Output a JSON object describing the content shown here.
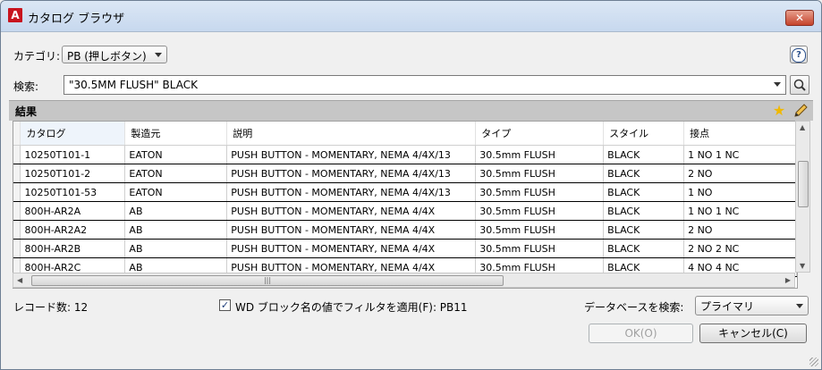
{
  "window": {
    "title": "カタログ ブラウザ",
    "app_icon": "A",
    "close_glyph": "✕"
  },
  "category": {
    "label": "カテゴリ:",
    "selected": "PB (押しボタン)"
  },
  "search": {
    "label": "検索:",
    "value": "\"30.5MM FLUSH\" BLACK"
  },
  "results": {
    "title": "結果"
  },
  "table": {
    "columns": [
      "カタログ",
      "製造元",
      "説明",
      "タイプ",
      "スタイル",
      "接点"
    ],
    "rows": [
      [
        "10250T101-1",
        "EATON",
        "PUSH BUTTON - MOMENTARY, NEMA 4/4X/13",
        "30.5mm FLUSH",
        "BLACK",
        "1 NO 1 NC"
      ],
      [
        "10250T101-2",
        "EATON",
        "PUSH BUTTON - MOMENTARY, NEMA 4/4X/13",
        "30.5mm FLUSH",
        "BLACK",
        "2 NO"
      ],
      [
        "10250T101-53",
        "EATON",
        "PUSH BUTTON - MOMENTARY, NEMA 4/4X/13",
        "30.5mm FLUSH",
        "BLACK",
        "1 NO"
      ],
      [
        "800H-AR2A",
        "AB",
        "PUSH BUTTON - MOMENTARY, NEMA 4/4X",
        "30.5mm FLUSH",
        "BLACK",
        "1 NO 1 NC"
      ],
      [
        "800H-AR2A2",
        "AB",
        "PUSH BUTTON - MOMENTARY, NEMA 4/4X",
        "30.5mm FLUSH",
        "BLACK",
        "2 NO"
      ],
      [
        "800H-AR2B",
        "AB",
        "PUSH BUTTON - MOMENTARY, NEMA 4/4X",
        "30.5mm FLUSH",
        "BLACK",
        "2 NO 2 NC"
      ],
      [
        "800H-AR2C",
        "AB",
        "PUSH BUTTON - MOMENTARY, NEMA 4/4X",
        "30.5mm FLUSH",
        "BLACK",
        "4 NO 4 NC"
      ]
    ]
  },
  "footer": {
    "record_count_label": "レコード数: 12",
    "filter_checkbox_label": "WD ブロック名の値でフィルタを適用(F): PB11",
    "filter_checked": true,
    "db_search_label": "データベースを検索:",
    "db_selected": "プライマリ",
    "ok_label": "OK(O)",
    "cancel_label": "キャンセル(C)"
  },
  "icons": {
    "help": "?",
    "star": "★",
    "hscroll_grip": "|||",
    "scroll_up": "▲",
    "scroll_down": "▼",
    "scroll_left": "◀",
    "scroll_right": "▶",
    "check": "✓"
  },
  "colors": {
    "title_bar": "#c7d8ee",
    "close_button": "#c5432b",
    "results_header": "#c6c6c6",
    "app_icon": "#c8141e"
  }
}
